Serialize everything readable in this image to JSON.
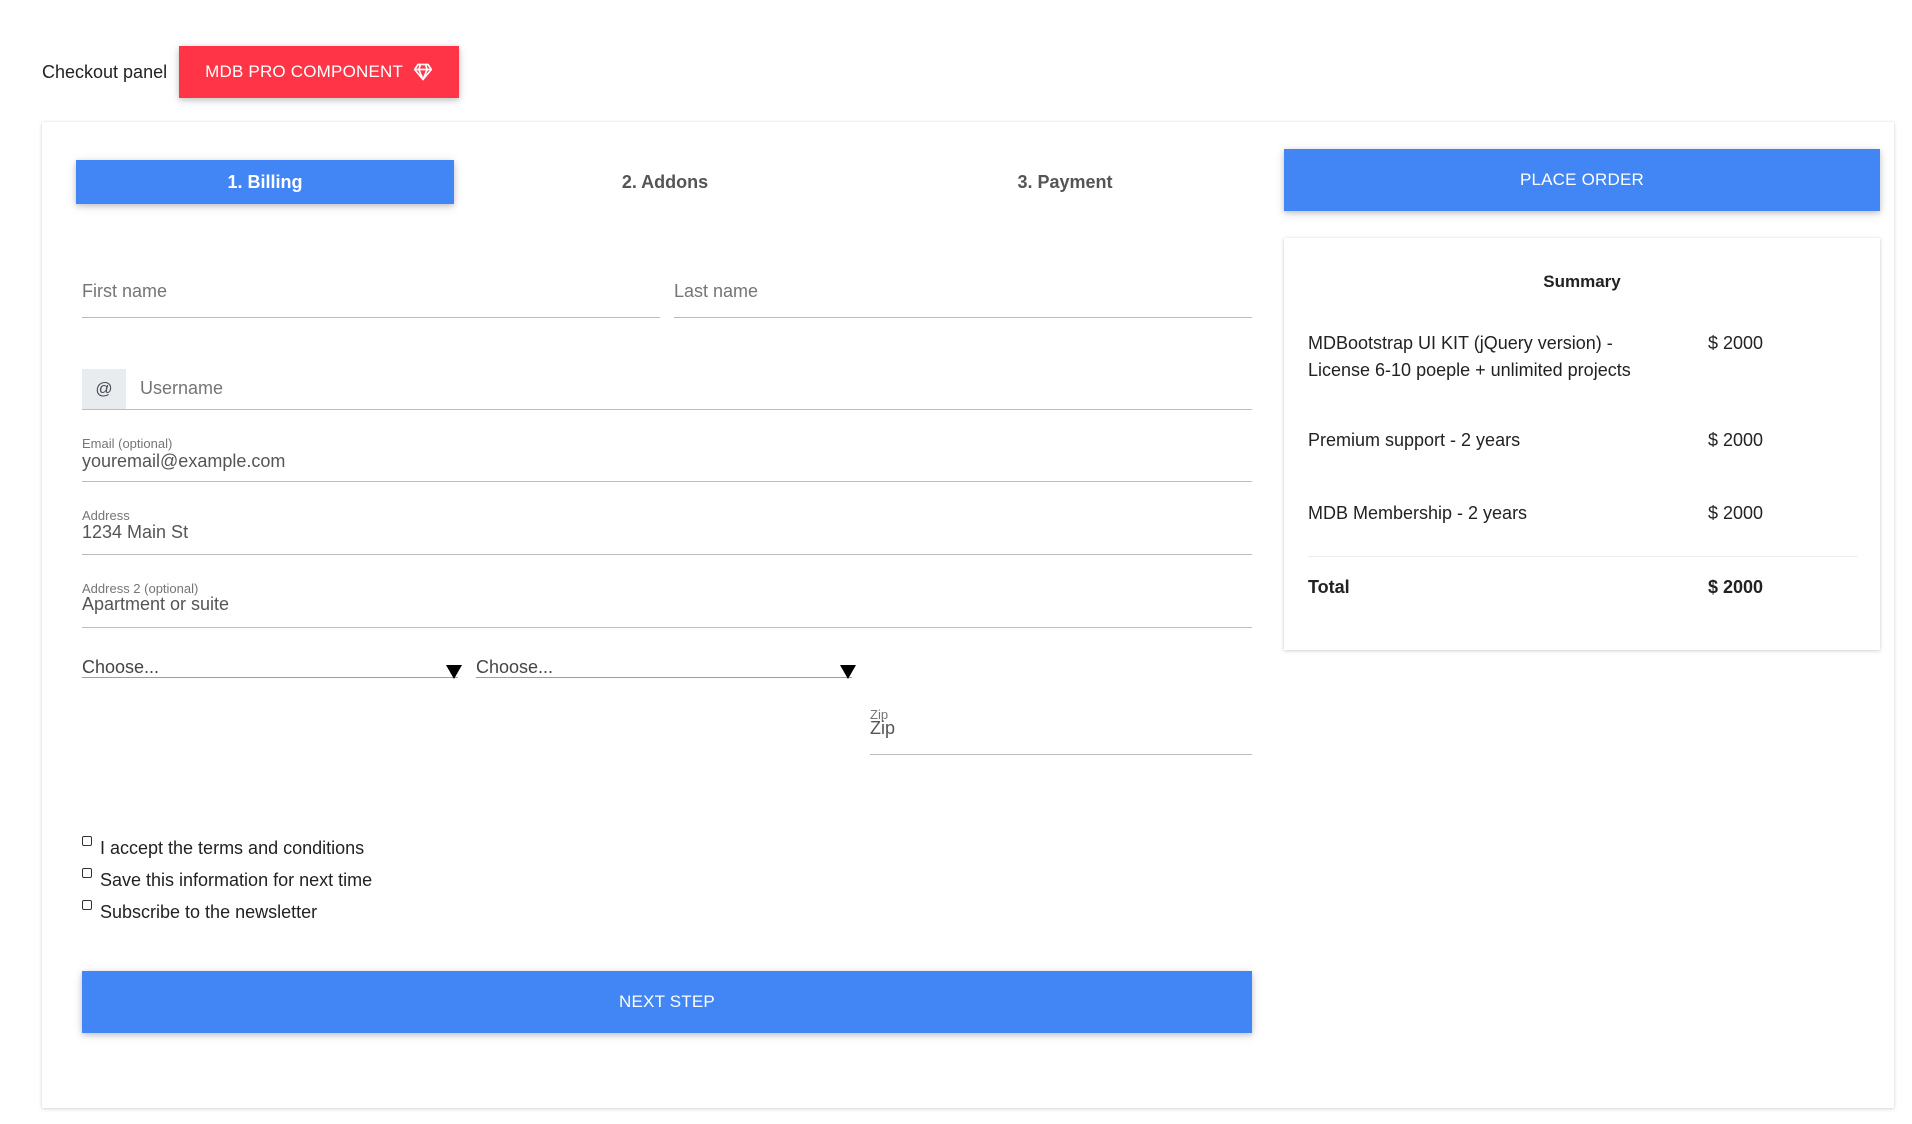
{
  "header": {
    "label": "Checkout panel",
    "badge_label": "MDB PRO COMPONENT",
    "badge_icon": "diamond-icon",
    "badge_color": "#ff3547"
  },
  "tabs": [
    {
      "label": "1. Billing",
      "active": true
    },
    {
      "label": "2. Addons",
      "active": false
    },
    {
      "label": "3. Payment",
      "active": false
    }
  ],
  "billing": {
    "first_name_placeholder": "First name",
    "last_name_placeholder": "Last name",
    "username_prefix": "@",
    "username_placeholder": "Username",
    "email_label": "Email (optional)",
    "email_placeholder": "youremail@example.com",
    "address_label": "Address",
    "address_placeholder": "1234 Main St",
    "address2_label": "Address 2 (optional)",
    "address2_placeholder": "Apartment or suite",
    "country_select_value": "Choose...",
    "state_select_value": "Choose...",
    "zip_label": "Zip",
    "zip_placeholder": "Zip"
  },
  "checkboxes": [
    {
      "label": "I accept the terms and conditions",
      "checked": false
    },
    {
      "label": "Save this information for next time",
      "checked": false
    },
    {
      "label": "Subscribe to the newsletter",
      "checked": false
    }
  ],
  "buttons": {
    "next_step": "NEXT STEP",
    "place_order": "PLACE ORDER",
    "primary_color": "#4285f4"
  },
  "summary": {
    "title": "Summary",
    "items": [
      {
        "name": "MDBootstrap UI KIT (jQuery version) - License 6-10 poeple + unlimited projects",
        "price": "$ 2000"
      },
      {
        "name": "Premium support - 2 years",
        "price": "$ 2000"
      },
      {
        "name": "MDB Membership - 2 years",
        "price": "$ 2000"
      }
    ],
    "total_label": "Total",
    "total_price": "$ 2000"
  }
}
